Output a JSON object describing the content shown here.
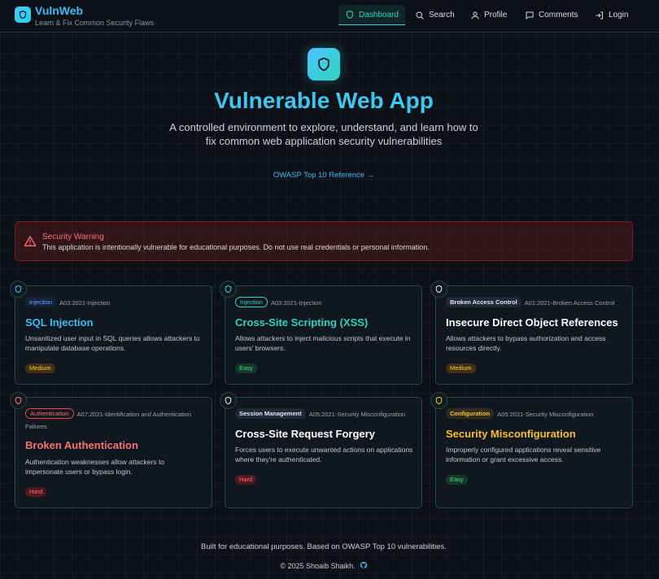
{
  "header": {
    "app_name": "VulnWeb",
    "tagline": "Learn & Fix Common Security Flaws",
    "nav": [
      {
        "label": "Dashboard",
        "icon": "shield-icon",
        "active": true
      },
      {
        "label": "Search",
        "icon": "search-icon",
        "active": false
      },
      {
        "label": "Profile",
        "icon": "user-icon",
        "active": false
      },
      {
        "label": "Comments",
        "icon": "comment-icon",
        "active": false
      },
      {
        "label": "Login",
        "icon": "login-icon",
        "active": false
      }
    ]
  },
  "hero": {
    "icon": "shield-icon",
    "title": "Vulnerable Web App",
    "subtitle": "A controlled environment to explore, understand, and learn how to fix common web application security vulnerabilities",
    "owasp_link": "OWASP Top 10 Reference →"
  },
  "warning": {
    "icon": "alert-triangle-icon",
    "title": "Security Warning",
    "text": "This application is intentionally vulnerable for educational purposes. Do not use real credentials or personal information."
  },
  "cards": [
    {
      "category": "Injection",
      "ref": "A03:2021-Injection",
      "title": "SQL Injection",
      "description": "Unsanitized user input in SQL queries allows attackers to manipulate database operations.",
      "difficulty": "Medium",
      "title_color": "#38bdf8"
    },
    {
      "category": "Injection",
      "ref": "A03:2021-Injection",
      "title": "Cross-Site Scripting (XSS)",
      "description": "Allows attackers to inject malicious scripts that execute in users' browsers.",
      "difficulty": "Easy",
      "title_color": "#2dd4bf"
    },
    {
      "category": "Broken Access Control",
      "ref": "A01:2021-Broken Access Control",
      "title": "Insecure Direct Object References",
      "description": "Allows attackers to bypass authorization and access resources directly.",
      "difficulty": "Medium",
      "title_color": "#ffffff"
    },
    {
      "category": "Authentication",
      "ref": "A07:2021-Identification and Authentication Failures",
      "title": "Broken Authentication",
      "description": "Authentication weaknesses allow attackers to impersonate users or bypass login.",
      "difficulty": "Hard",
      "title_color": "#f87171"
    },
    {
      "category": "Session Management",
      "ref": "A05:2021-Security Misconfiguration",
      "title": "Cross-Site Request Forgery",
      "description": "Forces users to execute unwanted actions on applications where they're authenticated.",
      "difficulty": "Hard",
      "title_color": "#ffffff"
    },
    {
      "category": "Configuration",
      "ref": "A05:2021-Security Misconfiguration",
      "title": "Security Misconfiguration",
      "description": "Improperly configured applications reveal sensitive information or grant excessive access.",
      "difficulty": "Easy",
      "title_color": "#fbbf24"
    }
  ],
  "footer": {
    "text": "Built for educational purposes. Based on OWASP Top 10 vulnerabilities.",
    "copyright": "© 2025 Shoaib Shaikh.",
    "icon": "github-icon"
  }
}
